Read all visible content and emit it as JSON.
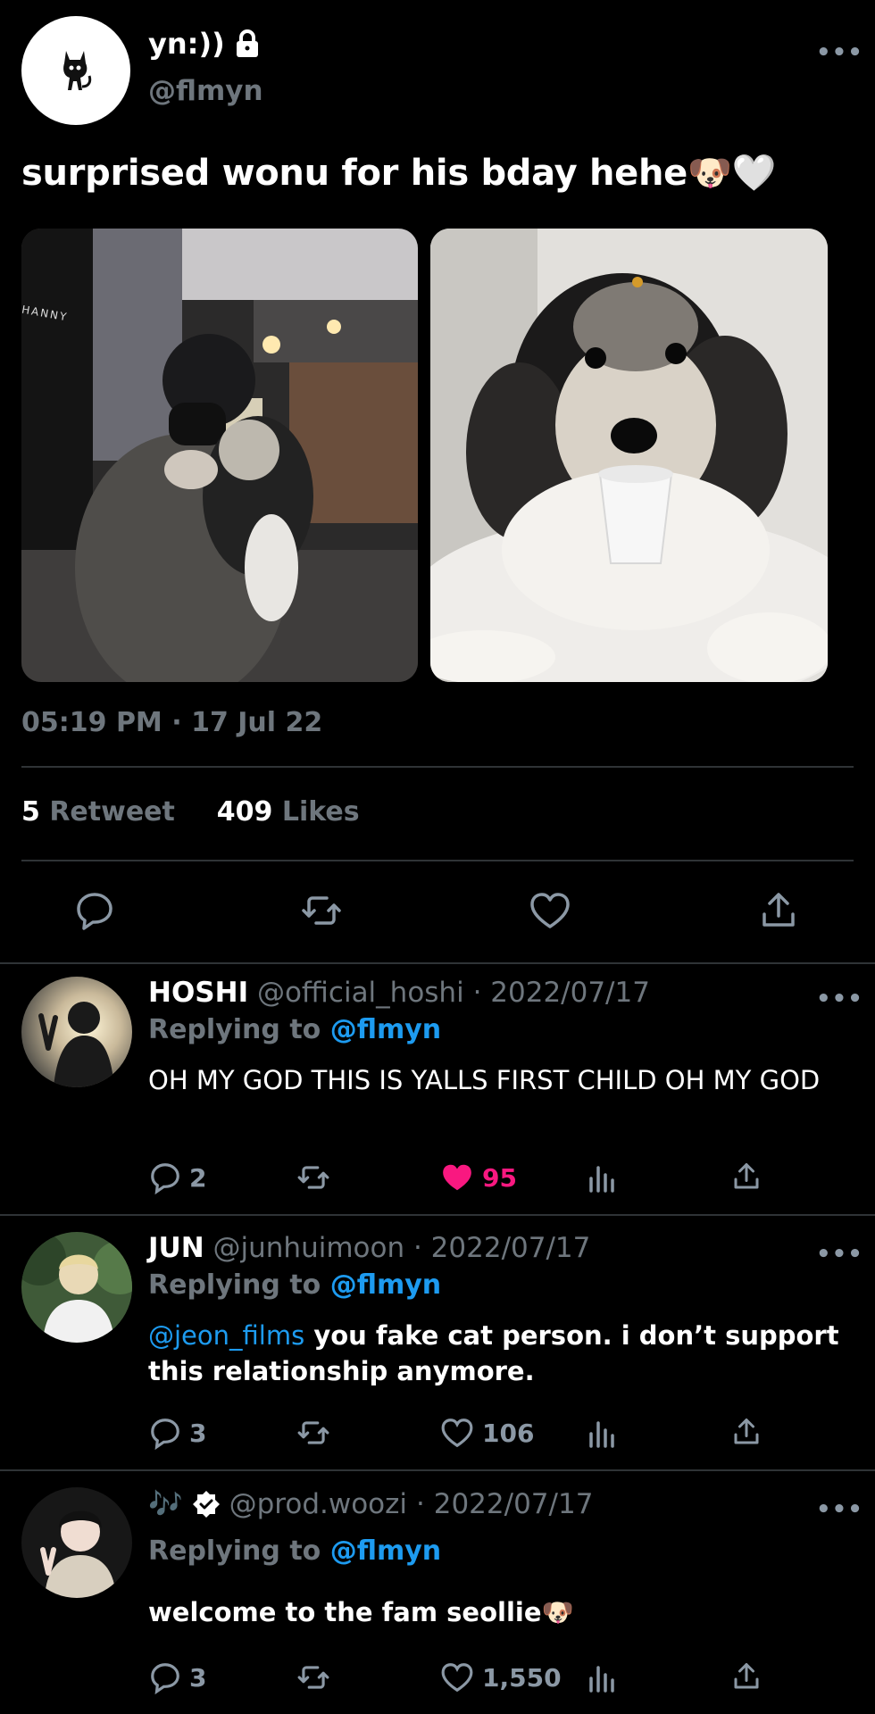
{
  "tweet": {
    "display_name": "yn:))",
    "handle": "@flmyn",
    "text": "surprised wonu for his bday hehe",
    "emoji": "🐶🤍",
    "timestamp": "05:19 PM · 17 Jul 22",
    "retweet_count": "5",
    "retweet_label": "Retweet",
    "like_count": "409",
    "like_label": "Likes",
    "photo_left_sign": "HANNY",
    "icons": [
      "reply-icon",
      "retweet-icon",
      "like-icon",
      "share-icon"
    ]
  },
  "replies": [
    {
      "name": "HOSHI",
      "handle": "@official_hoshi",
      "date": "· 2022/07/17",
      "replying_label": "Replying to",
      "replying_handle": "@flmyn",
      "text": "OH MY GOD THIS IS YALLS FIRST CHILD OH MY GOD",
      "replies": "2",
      "likes": "95",
      "liked": true
    },
    {
      "name": "JUN",
      "handle": "@junhuimoon",
      "date": "· 2022/07/17",
      "replying_label": "Replying to",
      "replying_handle": "@flmyn",
      "mention": "@jeon_films",
      "text": "you fake cat person. i don’t support this relationship anymore.",
      "replies": "3",
      "likes": "106",
      "liked": false
    },
    {
      "name": "🎶",
      "handle": "@prod.woozi",
      "date": "· 2022/07/17",
      "replying_label": "Replying to",
      "replying_handle": "@flmyn",
      "text": "welcome to the fam seollie",
      "emoji": "🐶",
      "replies": "3",
      "likes": "1,550",
      "liked": false
    }
  ],
  "colors": {
    "accent": "#1d9bf0",
    "like": "#f91880",
    "muted": "#6e767d",
    "divider": "#2f3336"
  }
}
